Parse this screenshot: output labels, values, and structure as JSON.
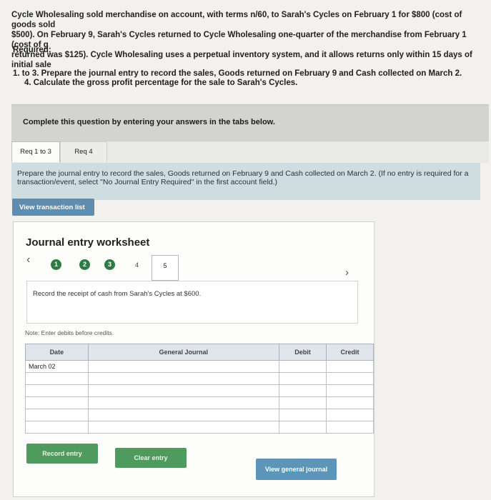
{
  "problem": {
    "line1": "Cycle Wholesaling sold merchandise on account, with terms n/60, to Sarah's Cycles on February 1 for $800 (cost of goods sold",
    "line2": "$500). On February 9, Sarah's Cycles returned to Cycle Wholesaling one-quarter of the merchandise from February 1 (cost of g",
    "line3": "returned was $125). Cycle Wholesaling uses a perpetual inventory system, and it allows returns only within 15 days of initial sale"
  },
  "required": {
    "heading": "Required:",
    "item1": "1. to 3. Prepare the journal entry to record the sales, Goods returned on February 9 and Cash collected on March 2.",
    "item2": "4. Calculate the gross profit percentage for the sale to Sarah's Cycles."
  },
  "banner": {
    "text": "Complete this question by entering your answers in the tabs below."
  },
  "tabs": [
    {
      "label": "Req 1 to 3"
    },
    {
      "label": "Req 4"
    }
  ],
  "instruction": {
    "text": "Prepare the journal entry to record the sales, Goods returned on February 9 and Cash collected on March 2. (If no entry is required for a transaction/event, select \"No Journal Entry Required\" in the first account field.)"
  },
  "view_transaction_list": "View transaction list",
  "worksheet": {
    "title": "Journal entry worksheet",
    "prev_icon": "chevron-left-icon",
    "next_icon": "chevron-right-icon",
    "steps": [
      "1",
      "2",
      "3",
      "4",
      "5"
    ],
    "current_step": "5",
    "description": "Record the receipt of cash from Sarah's Cycles at $600.",
    "note": "Note: Enter debits before credits.",
    "table": {
      "headers": {
        "date": "Date",
        "account": "General Journal",
        "debit": "Debit",
        "credit": "Credit"
      },
      "rows": [
        {
          "date": "March 02",
          "account": "",
          "debit": "",
          "credit": ""
        },
        {
          "date": "",
          "account": "",
          "debit": "",
          "credit": ""
        },
        {
          "date": "",
          "account": "",
          "debit": "",
          "credit": ""
        },
        {
          "date": "",
          "account": "",
          "debit": "",
          "credit": ""
        },
        {
          "date": "",
          "account": "",
          "debit": "",
          "credit": ""
        },
        {
          "date": "",
          "account": "",
          "debit": "",
          "credit": ""
        }
      ]
    },
    "buttons": {
      "record": "Record entry",
      "clear": "Clear entry",
      "view_general": "View general journal"
    }
  },
  "colors": {
    "step_done": "#2f7b45",
    "primary_button": "#5e8daf",
    "green_button": "#4f9a5d",
    "info_bg": "#cfdde1"
  }
}
